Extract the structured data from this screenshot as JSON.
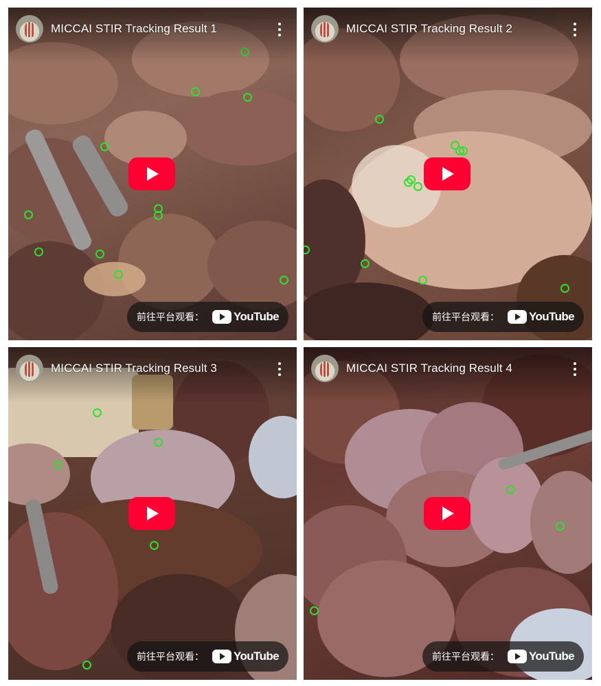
{
  "videos": [
    {
      "title": "MICCAI STIR Tracking Result 1",
      "watch_label": "前往平台观看：",
      "brand": "YouTube",
      "menu_icon": "more-vert-icon"
    },
    {
      "title": "MICCAI STIR Tracking Result 2",
      "watch_label": "前往平台观看：",
      "brand": "YouTube",
      "menu_icon": "more-vert-icon"
    },
    {
      "title": "MICCAI STIR Tracking Result 3",
      "watch_label": "前往平台观看：",
      "brand": "YouTube",
      "menu_icon": "more-vert-icon"
    },
    {
      "title": "MICCAI STIR Tracking Result 4",
      "watch_label": "前往平台观看：",
      "brand": "YouTube",
      "menu_icon": "more-vert-icon"
    }
  ],
  "colors": {
    "play_button": "#ff0033",
    "tracking_marker": "#2de02d",
    "overlay_pill": "#141414"
  }
}
